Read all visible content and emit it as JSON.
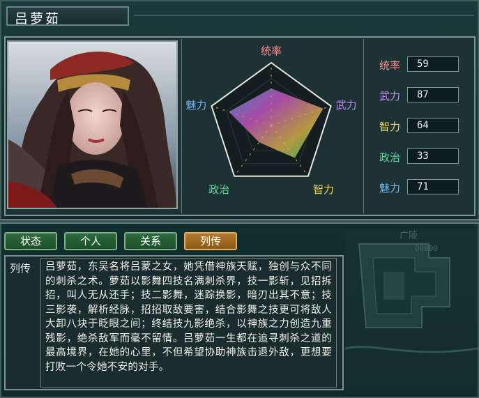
{
  "character": {
    "name": "吕萝茹"
  },
  "radar": {
    "labels": [
      {
        "text": "统率",
        "color": "#ff8e95"
      },
      {
        "text": "武力",
        "color": "#c68af5"
      },
      {
        "text": "智力",
        "color": "#f2d65a"
      },
      {
        "text": "政治",
        "color": "#63d89a"
      },
      {
        "text": "魅力",
        "color": "#6fb6f2"
      }
    ]
  },
  "stats": [
    {
      "label": "统率",
      "value": "59",
      "color": "#ff8e95"
    },
    {
      "label": "武力",
      "value": "87",
      "color": "#c68af5"
    },
    {
      "label": "智力",
      "value": "64",
      "color": "#f2d65a"
    },
    {
      "label": "政治",
      "value": "33",
      "color": "#63d89a"
    },
    {
      "label": "魅力",
      "value": "71",
      "color": "#6fb6f2"
    }
  ],
  "chart_data": {
    "type": "radar",
    "axes": [
      "统率",
      "武力",
      "智力",
      "政治",
      "魅力"
    ],
    "values": [
      59,
      87,
      64,
      33,
      71
    ],
    "max": 100
  },
  "tabs": [
    {
      "label": "状态",
      "active": false
    },
    {
      "label": "个人",
      "active": false
    },
    {
      "label": "关系",
      "active": false
    },
    {
      "label": "列传",
      "active": true
    }
  ],
  "map": {
    "city": "广陵",
    "number": "00000"
  },
  "bio": {
    "label": "列传",
    "text": "吕萝茹，东吴名将吕蒙之女，她凭借神族天赋，独创与众不同的刺杀之术。萝茹以影舞四技名满刺杀界，技一影斩，见招拆招，叫人无从还手；技二影舞，迷踪换影，暗刃出其不意；技三影袭，解析经脉，招招取敌要害，结合影舞之技更可将敌人大卸八块于眨眼之间；终结技九影绝杀，以神族之力创造九重残影，绝杀敌军而毫不留情。吕萝茹一生都在追寻刺杀之道的最高境界，在她的心里，不但希望协助神族击退外敌，更想要打败一个令她不安的对手。"
  }
}
